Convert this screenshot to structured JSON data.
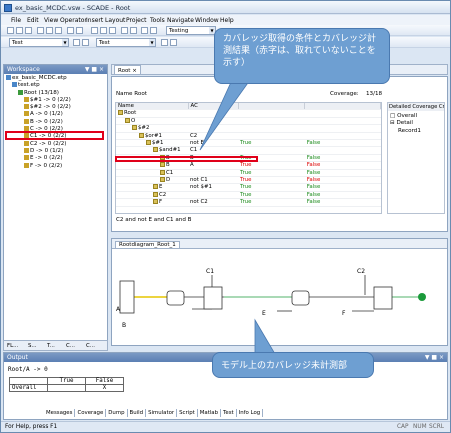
{
  "app": {
    "title": "ex_basic_MCDC.vsw - SCADE - Root"
  },
  "menu": [
    "File",
    "Edit",
    "View",
    "Operator",
    "Insert",
    "Layout",
    "Project",
    "Tools",
    "Navigate",
    "Window",
    "Help"
  ],
  "toolbar": {
    "combo1": "Testing",
    "combo2": "Test",
    "combo3": "Test"
  },
  "workspace": {
    "title": "Workspace",
    "items": [
      {
        "label": "ex_basic_MCDC.etp",
        "indent": 0
      },
      {
        "label": "test.etp",
        "indent": 1
      },
      {
        "label": "Root (13/18)",
        "indent": 2
      },
      {
        "label": "$#1 -> 0 (2/2)",
        "indent": 3
      },
      {
        "label": "$#2 -> 0 (2/2)",
        "indent": 3
      },
      {
        "label": "A -> 0 (1/2)",
        "indent": 3
      },
      {
        "label": "B -> 0 (2/2)",
        "indent": 3
      },
      {
        "label": "C -> 0 (2/2)",
        "indent": 3
      },
      {
        "label": "C1 -> 0 (2/2)",
        "indent": 3
      },
      {
        "label": "C2 -> 0 (2/2)",
        "indent": 3
      },
      {
        "label": "D -> 0 (1/2)",
        "indent": 3
      },
      {
        "label": "E -> 0 (2/2)",
        "indent": 3
      },
      {
        "label": "F -> 0 (2/2)",
        "indent": 3
      }
    ],
    "tabs": [
      "FL...",
      "S...",
      "T...",
      "C...",
      "C..."
    ]
  },
  "root_tab": {
    "label": "Root"
  },
  "root_view": {
    "root_label": "Name  Root",
    "coverage_label": "Coverage:",
    "coverage_value": "13/18",
    "col_name": "Name",
    "col_ac": "AC",
    "rows": [
      {
        "name": "Root",
        "ac": "",
        "t": "",
        "f": "",
        "indent": 0
      },
      {
        "name": "O",
        "ac": "",
        "t": "",
        "f": "",
        "indent": 1
      },
      {
        "name": "$#2",
        "ac": "",
        "t": "",
        "f": "",
        "indent": 2
      },
      {
        "name": "$or#1",
        "ac": "C2",
        "t": "",
        "f": "",
        "indent": 3
      },
      {
        "name": "$#1",
        "ac": "not E",
        "t": "True",
        "f": "False",
        "indent": 4
      },
      {
        "name": "$and#1",
        "ac": "C1",
        "t": "",
        "f": "",
        "indent": 5
      },
      {
        "name": "B",
        "ac": "B",
        "t": "True",
        "f": "False",
        "indent": 6
      },
      {
        "name": "B",
        "ac": "A",
        "t": "True",
        "f": "False",
        "indent": 6
      },
      {
        "name": "C1",
        "ac": "",
        "t": "True",
        "f": "False",
        "indent": 6
      },
      {
        "name": "D",
        "ac": "not C1",
        "t": "True",
        "f": "False",
        "indent": 6
      },
      {
        "name": "E",
        "ac": "not $#1",
        "t": "True",
        "f": "False",
        "indent": 5
      },
      {
        "name": "C2",
        "ac": "",
        "t": "True",
        "f": "False",
        "indent": 5
      },
      {
        "name": "F",
        "ac": "not C2",
        "t": "True",
        "f": "False",
        "indent": 5
      }
    ],
    "expr": "C2 and not E and C1 and B",
    "detail_title": "Detailed Coverage Crite",
    "detail_items": [
      "Overall",
      "Detail",
      "Record1"
    ]
  },
  "diagram": {
    "title": "Rootdiagram_Root_1",
    "labels": {
      "A": "A",
      "B": "B",
      "C1": "C1",
      "C2": "C2",
      "E": "E",
      "F": "F"
    }
  },
  "output": {
    "title": "Output",
    "line1": "Root/A -> 0",
    "col_true": "True",
    "col_false": "False",
    "row_label": "Overall",
    "row_true": "",
    "row_false": "X",
    "tabs": [
      "Messages",
      "Coverage",
      "Dump",
      "Build",
      "Simulator",
      "Script",
      "Matlab",
      "Test",
      "Info Log"
    ]
  },
  "status": {
    "left": "For Help, press F1",
    "ind1": "CAP",
    "ind2": "NUM",
    "ind3": "SCRL"
  },
  "callouts": {
    "top": "カバレッジ取得の条件とカバレッジ計測結果（赤字は、取れていないことを示す）",
    "bottom": "モデル上のカバレッジ未計測部"
  }
}
